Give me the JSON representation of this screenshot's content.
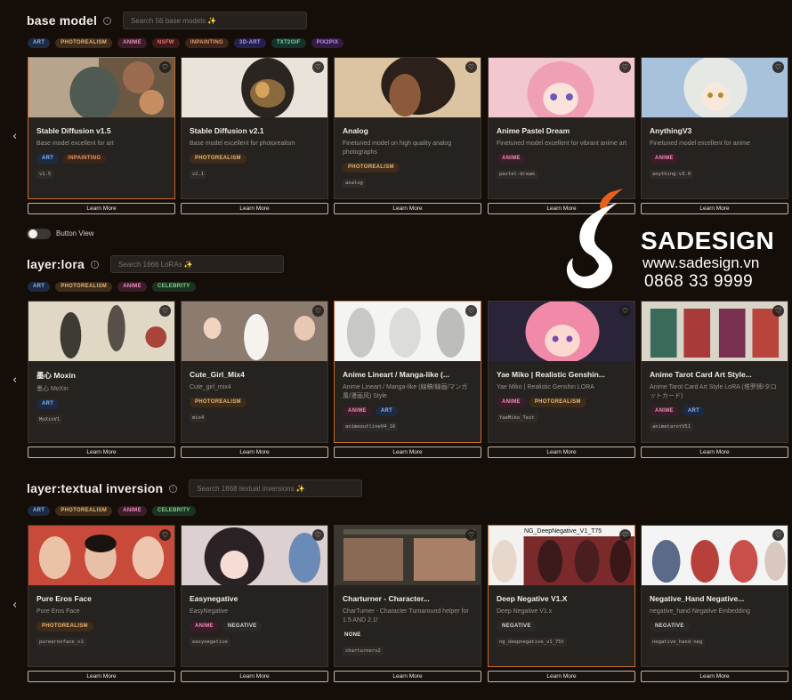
{
  "sections": [
    {
      "title": "base model",
      "search_placeholder": "Search 56 base models ✨",
      "filter_tags": [
        "ART",
        "PHOTOREALISM",
        "ANIME",
        "NSFW",
        "INPAINTING",
        "3D-ART",
        "TXT2GIF",
        "PIX2PIX"
      ],
      "cards": [
        {
          "title": "Stable Diffusion v1.5",
          "desc": "Base model excellent for art",
          "tags": [
            "ART",
            "INPAINTING"
          ],
          "id": "v1.5"
        },
        {
          "title": "Stable Diffusion v2.1",
          "desc": "Base model excellent for photorealism",
          "tags": [
            "PHOTOREALISM"
          ],
          "id": "v2.1"
        },
        {
          "title": "Analog",
          "desc": "Finetuned model on high quality analog photographs",
          "tags": [
            "PHOTOREALISM"
          ],
          "id": "analog"
        },
        {
          "title": "Anime Pastel Dream",
          "desc": "Finetuned model excellent for vibrant anime art",
          "tags": [
            "ANIME"
          ],
          "id": "pastel-dream"
        },
        {
          "title": "AnythingV3",
          "desc": "Finetuned model excellent for anime",
          "tags": [
            "ANIME"
          ],
          "id": "anything-v3.0"
        }
      ]
    },
    {
      "title": "layer:lora",
      "search_placeholder": "Search 1666 LoRAs ✨",
      "filter_tags": [
        "ART",
        "PHOTOREALISM",
        "ANIME",
        "CELEBRITY"
      ],
      "cards": [
        {
          "title": "墨心 Moxin",
          "desc": "墨心 MoXin",
          "tags": [
            "ART"
          ],
          "id": "MoXinV1"
        },
        {
          "title": "Cute_Girl_Mix4",
          "desc": "Cute_girl_mix4",
          "tags": [
            "PHOTOREALISM"
          ],
          "id": "mix4"
        },
        {
          "title": "Anime Lineart / Manga-like (...",
          "desc": "Anime Lineart / Manga-like (線稿/線画/マンガ風/漫画风) Style",
          "tags": [
            "ANIME",
            "ART"
          ],
          "id": "animeoutlineV4_16"
        },
        {
          "title": "Yae Miko | Realistic Genshin...",
          "desc": "Yae Miko | Realistic Genshin LORA",
          "tags": [
            "ANIME",
            "PHOTOREALISM"
          ],
          "id": "YaeMiko_Test"
        },
        {
          "title": "Anime Tarot Card Art Style...",
          "desc": "Anime Tarot Card Art Style LoRA (塔罗牌/タロットカード)",
          "tags": [
            "ANIME",
            "ART"
          ],
          "id": "animetarotV51"
        }
      ]
    },
    {
      "title": "layer:textual inversion",
      "search_placeholder": "Search 1868 textual inversions ✨",
      "filter_tags": [
        "ART",
        "PHOTOREALISM",
        "ANIME",
        "CELEBRITY"
      ],
      "cards": [
        {
          "title": "Pure Eros Face",
          "desc": "Pure Eros Face",
          "tags": [
            "PHOTOREALISM"
          ],
          "id": "pureerosface_v1"
        },
        {
          "title": "Easynegative",
          "desc": "EasyNegative",
          "tags": [
            "ANIME",
            "NEGATIVE"
          ],
          "id": "easynegative"
        },
        {
          "title": "Charturner - Character...",
          "desc": "CharTurner - Character Turnaround helper for 1.5 AND 2.1!",
          "tags": [
            "NONE"
          ],
          "id": "charturnerv2"
        },
        {
          "title": "Deep Negative V1.X",
          "desc": "Deep Negative V1.x",
          "tags": [
            "NEGATIVE"
          ],
          "id": "ng_deepnegative_v1_75t",
          "thumb_caption": "NG_DeepNegative_V1_T75"
        },
        {
          "title": "Negative_Hand Negative...",
          "desc": "negative_hand Negative Embedding",
          "tags": [
            "NEGATIVE"
          ],
          "id": "negative_hand-neg"
        }
      ]
    }
  ],
  "learn_more_label": "Learn More",
  "toggle_label": "Button View",
  "info_glyph": "i",
  "chevron_glyph": "‹",
  "heart_glyph": "♡",
  "watermark": {
    "name": "SADESIGN",
    "url": "www.sadesign.vn",
    "phone": "0868 33 9999"
  }
}
